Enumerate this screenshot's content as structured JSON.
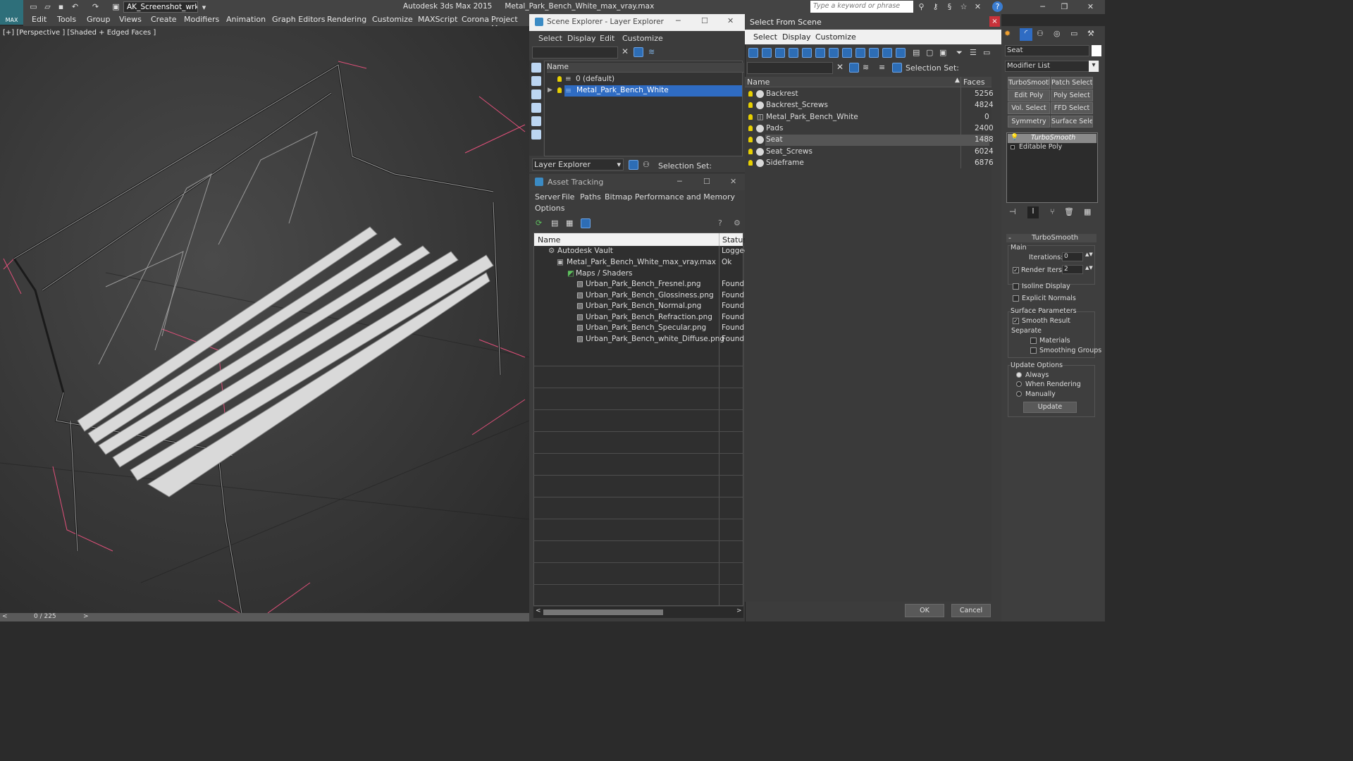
{
  "app": {
    "logo": "MAX",
    "workspace": "AK_Screenshot_wrksp",
    "title": "Autodesk 3ds Max  2015",
    "file": "Metal_Park_Bench_White_max_vray.max",
    "search_placeholder": "Type a keyword or phrase"
  },
  "menu": [
    "Edit",
    "Tools",
    "Group",
    "Views",
    "Create",
    "Modifiers",
    "Animation",
    "Graph Editors",
    "Rendering",
    "Customize",
    "MAXScript",
    "Corona",
    "Project Man"
  ],
  "viewport": {
    "label": "[+] [Perspective ] [Shaded + Edged Faces ]"
  },
  "timeline": {
    "frame": "0 / 225"
  },
  "scene_explorer": {
    "title": "Scene Explorer - Layer Explorer",
    "menu": [
      "Select",
      "Display",
      "Edit",
      "Customize"
    ],
    "col_name": "Name",
    "layers": [
      "0 (default)",
      "Metal_Park_Bench_White"
    ],
    "footer_dropdown": "Layer Explorer",
    "selection_set": "Selection Set:"
  },
  "asset_tracking": {
    "title": "Asset Tracking",
    "menu": [
      "Server",
      "File",
      "Paths",
      "Bitmap Performance and Memory",
      "Options"
    ],
    "col_name": "Name",
    "col_status": "Status",
    "rows": [
      {
        "name": "Autodesk Vault",
        "status": "Logged"
      },
      {
        "name": "Metal_Park_Bench_White_max_vray.max",
        "status": "Ok"
      },
      {
        "name": "Maps / Shaders",
        "status": ""
      },
      {
        "name": "Urban_Park_Bench_Fresnel.png",
        "status": "Found"
      },
      {
        "name": "Urban_Park_Bench_Glossiness.png",
        "status": "Found"
      },
      {
        "name": "Urban_Park_Bench_Normal.png",
        "status": "Found"
      },
      {
        "name": "Urban_Park_Bench_Refraction.png",
        "status": "Found"
      },
      {
        "name": "Urban_Park_Bench_Specular.png",
        "status": "Found"
      },
      {
        "name": "Urban_Park_Bench_white_Diffuse.png",
        "status": "Found"
      }
    ]
  },
  "select_from_scene": {
    "title": "Select From Scene",
    "menu": [
      "Select",
      "Display",
      "Customize"
    ],
    "selection_set": "Selection Set:",
    "col_name": "Name",
    "col_faces": "Faces",
    "rows": [
      {
        "name": "Backrest",
        "faces": "5256"
      },
      {
        "name": "Backrest_Screws",
        "faces": "4824"
      },
      {
        "name": "Metal_Park_Bench_White",
        "faces": "0"
      },
      {
        "name": "Pads",
        "faces": "2400"
      },
      {
        "name": "Seat",
        "faces": "1488"
      },
      {
        "name": "Seat_Screws",
        "faces": "6024"
      },
      {
        "name": "Sideframe",
        "faces": "6876"
      }
    ],
    "ok": "OK",
    "cancel": "Cancel"
  },
  "command_panel": {
    "object_name": "Seat",
    "modifier_list": "Modifier List",
    "mod_buttons": [
      "TurboSmooth",
      "Patch Select",
      "Edit Poly",
      "Poly Select",
      "Vol. Select",
      "FFD Select",
      "Symmetry",
      "Surface Select"
    ],
    "stack": [
      "TurboSmooth",
      "Editable Poly"
    ],
    "rollout_title": "TurboSmooth",
    "main": "Main",
    "iterations_label": "Iterations:",
    "iterations": "0",
    "render_iters_label": "Render Iters:",
    "render_iters": "2",
    "isoline": "Isoline Display",
    "explicit": "Explicit Normals",
    "surface_params": "Surface Parameters",
    "smooth_result": "Smooth Result",
    "separate": "Separate",
    "materials": "Materials",
    "smoothing_groups": "Smoothing Groups",
    "update_options": "Update Options",
    "always": "Always",
    "when_rendering": "When Rendering",
    "manually": "Manually",
    "update": "Update"
  }
}
